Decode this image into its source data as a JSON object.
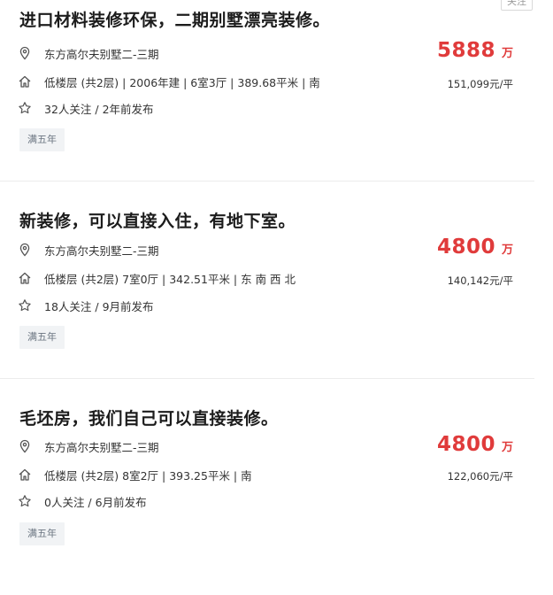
{
  "follow_label": "关注",
  "colors": {
    "price": "#e03b3b",
    "tag_bg": "#f1f3f5"
  },
  "listings": [
    {
      "title": "进口材料装修环保，二期别墅漂亮装修。",
      "community": "东方高尔夫别墅二-三期",
      "house_info": "低楼层 (共2层) | 2006年建 | 6室3厅 | 389.68平米 | 南",
      "follow_info": "32人关注 / 2年前发布",
      "tag": "满五年",
      "price": "5888",
      "price_unit": "万",
      "unit_price": "151,099元/平"
    },
    {
      "title": "新装修，可以直接入住，有地下室。",
      "community": "东方高尔夫别墅二-三期",
      "house_info": "低楼层 (共2层) 7室0厅 | 342.51平米 | 东 南 西 北",
      "follow_info": "18人关注 / 9月前发布",
      "tag": "满五年",
      "price": "4800",
      "price_unit": "万",
      "unit_price": "140,142元/平"
    },
    {
      "title": "毛坯房，我们自己可以直接装修。",
      "community": "东方高尔夫别墅二-三期",
      "house_info": "低楼层 (共2层) 8室2厅 | 393.25平米 | 南",
      "follow_info": "0人关注 / 6月前发布",
      "tag": "满五年",
      "price": "4800",
      "price_unit": "万",
      "unit_price": "122,060元/平"
    }
  ]
}
